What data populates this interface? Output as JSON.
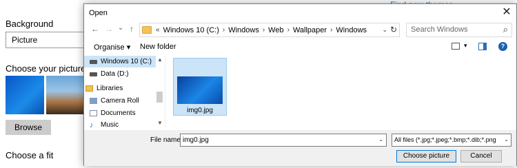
{
  "background_settings": {
    "find_link": "Find new themes",
    "background_label": "Background",
    "background_value": "Picture",
    "choose_picture_label": "Choose your picture",
    "browse_label": "Browse",
    "choose_fit_label": "Choose a fit"
  },
  "dialog": {
    "title": "Open",
    "close_glyph": "✕",
    "nav": {
      "back": "←",
      "forward": "→",
      "recent": "⌄",
      "up": "↑"
    },
    "address": {
      "prefix": "«",
      "crumbs": [
        "Windows 10 (C:)",
        "Windows",
        "Web",
        "Wallpaper",
        "Windows"
      ],
      "separator": "›",
      "dropdown": "⌄",
      "refresh": "↻"
    },
    "search": {
      "placeholder": "Search Windows",
      "icon": "search-icon",
      "glyph": "⌕"
    },
    "toolbar": {
      "organise": "Organise ▾",
      "new_folder": "New folder",
      "view_dropdown": "▾",
      "help": "?"
    },
    "nav_pane": {
      "items": [
        {
          "label": "Windows 10 (C:)",
          "icon": "drive-icon",
          "selected": true
        },
        {
          "label": "Data (D:)",
          "icon": "drive-icon",
          "selected": false
        },
        {
          "label": "Libraries",
          "icon": "libraries-icon",
          "selected": false
        },
        {
          "label": "Camera Roll",
          "icon": "camera-roll-icon",
          "selected": false
        },
        {
          "label": "Documents",
          "icon": "documents-icon",
          "selected": false
        },
        {
          "label": "Music",
          "icon": "music-icon",
          "selected": false
        }
      ],
      "scroll_up": "▲",
      "scroll_down": "▼"
    },
    "files": [
      {
        "name": "img0.jpg",
        "selected": true
      }
    ],
    "footer": {
      "file_name_label": "File name:",
      "file_name_value": "img0.jpg",
      "filter_value": "All files (*.jpg;*.jpeg;*.bmp;*.dib;*.png",
      "dropdown": "⌄",
      "choose_button": "Choose picture",
      "cancel_button": "Cancel"
    }
  },
  "colors": {
    "accent": "#0078d7",
    "selection": "#cce4f7",
    "link": "#0067c0"
  }
}
